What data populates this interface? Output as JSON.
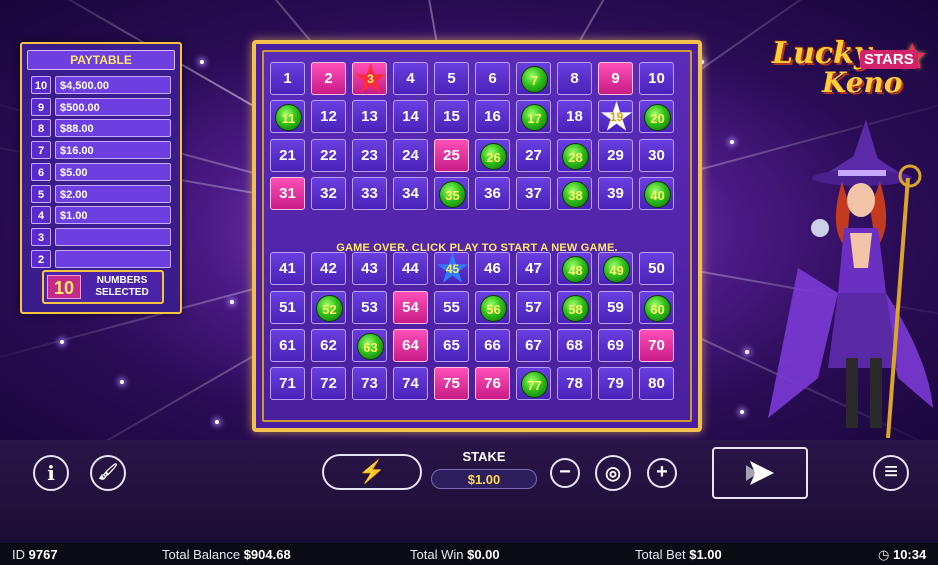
{
  "paytable": {
    "title": "PAYTABLE",
    "rows": [
      {
        "hits": "10",
        "pay": "$4,500.00"
      },
      {
        "hits": "9",
        "pay": "$500.00"
      },
      {
        "hits": "8",
        "pay": "$88.00"
      },
      {
        "hits": "7",
        "pay": "$16.00"
      },
      {
        "hits": "6",
        "pay": "$5.00"
      },
      {
        "hits": "5",
        "pay": "$2.00"
      },
      {
        "hits": "4",
        "pay": "$1.00"
      },
      {
        "hits": "3",
        "pay": ""
      },
      {
        "hits": "2",
        "pay": ""
      }
    ],
    "numbers_selected_count": "10",
    "numbers_selected_label_line1": "NUMBERS",
    "numbers_selected_label_line2": "SELECTED"
  },
  "board": {
    "message": "GAME OVER. CLICK PLAY TO START A NEW GAME.",
    "selected": [
      2,
      3,
      9,
      19,
      25,
      31,
      45,
      54,
      64,
      70,
      75,
      76
    ],
    "drawn": [
      7,
      11,
      17,
      20,
      26,
      28,
      35,
      38,
      40,
      48,
      49,
      52,
      56,
      58,
      60,
      63,
      77
    ],
    "star_red": [
      3
    ],
    "star_white": [
      19
    ],
    "star_blue": [
      45
    ]
  },
  "logo": {
    "line1": "Lucky",
    "line2": "STARS",
    "line3": "Keno"
  },
  "controls": {
    "info_icon_glyph": "i",
    "clear_icon_glyph": "🖌",
    "quick_pick_glyph": "⚡",
    "stake_label": "STAKE",
    "stake_value": "$1.00",
    "minus_glyph": "−",
    "chips_glyph": "◎",
    "plus_glyph": "+",
    "menu_glyph": "≡"
  },
  "status": {
    "id_label": "ID",
    "id_value": "9767",
    "balance_label": "Total Balance",
    "balance_value": "$904.68",
    "win_label": "Total Win",
    "win_value": "$0.00",
    "bet_label": "Total Bet",
    "bet_value": "$1.00",
    "clock_time": "10:34"
  },
  "colors": {
    "gold_frame": "#f2c14c",
    "selected_pink": "#e0309c",
    "drawn_green": "#2fc01a",
    "number_yellow": "#fff46a"
  }
}
